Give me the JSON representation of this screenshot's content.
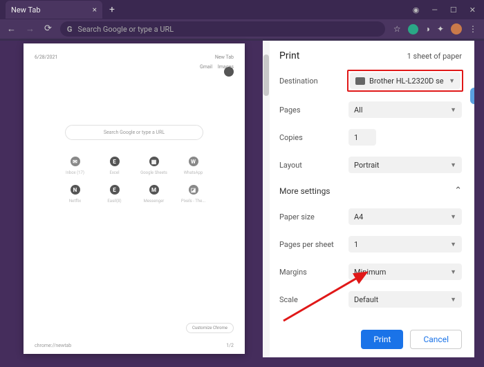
{
  "window": {
    "tab_title": "New Tab",
    "plus": "+",
    "win_min": "—",
    "win_max": "☐",
    "win_close": "✕"
  },
  "toolbar": {
    "back": "←",
    "forward": "→",
    "reload": "⟳",
    "url_icon": "G",
    "url_placeholder": "Search Google or type a URL",
    "star": "☆",
    "puzzle": "✦",
    "menu": "⋮"
  },
  "preview": {
    "date": "6/28/2021",
    "title": "New Tab",
    "link_gmail": "Gmail",
    "link_images": "Images",
    "search_placeholder": "Search Google or type a URL",
    "shortcuts": [
      {
        "icon": "✉",
        "label": "Inbox (17)"
      },
      {
        "icon": "E",
        "label": "Excel"
      },
      {
        "icon": "▦",
        "label": "Google Sheets"
      },
      {
        "icon": "W",
        "label": "WhatsApp"
      },
      {
        "icon": "N",
        "label": "Netflix"
      },
      {
        "icon": "E",
        "label": "Easil(8)"
      },
      {
        "icon": "M",
        "label": "Messenger"
      },
      {
        "icon": "◪",
        "label": "Pixels - The..."
      }
    ],
    "customize": "Customize Chrome",
    "footer_left": "chrome://newtab",
    "footer_right": "1/2"
  },
  "panel": {
    "title": "Print",
    "sheets": "1 sheet of paper",
    "rows": {
      "destination": {
        "label": "Destination",
        "value": "Brother HL-L2320D se"
      },
      "pages": {
        "label": "Pages",
        "value": "All"
      },
      "copies": {
        "label": "Copies",
        "value": "1"
      },
      "layout": {
        "label": "Layout",
        "value": "Portrait"
      },
      "more": {
        "label": "More settings"
      },
      "paper": {
        "label": "Paper size",
        "value": "A4"
      },
      "pps": {
        "label": "Pages per sheet",
        "value": "1"
      },
      "margins": {
        "label": "Margins",
        "value": "Minimum"
      },
      "scale": {
        "label": "Scale",
        "value": "Default"
      }
    },
    "print_btn": "Print",
    "cancel_btn": "Cancel"
  }
}
